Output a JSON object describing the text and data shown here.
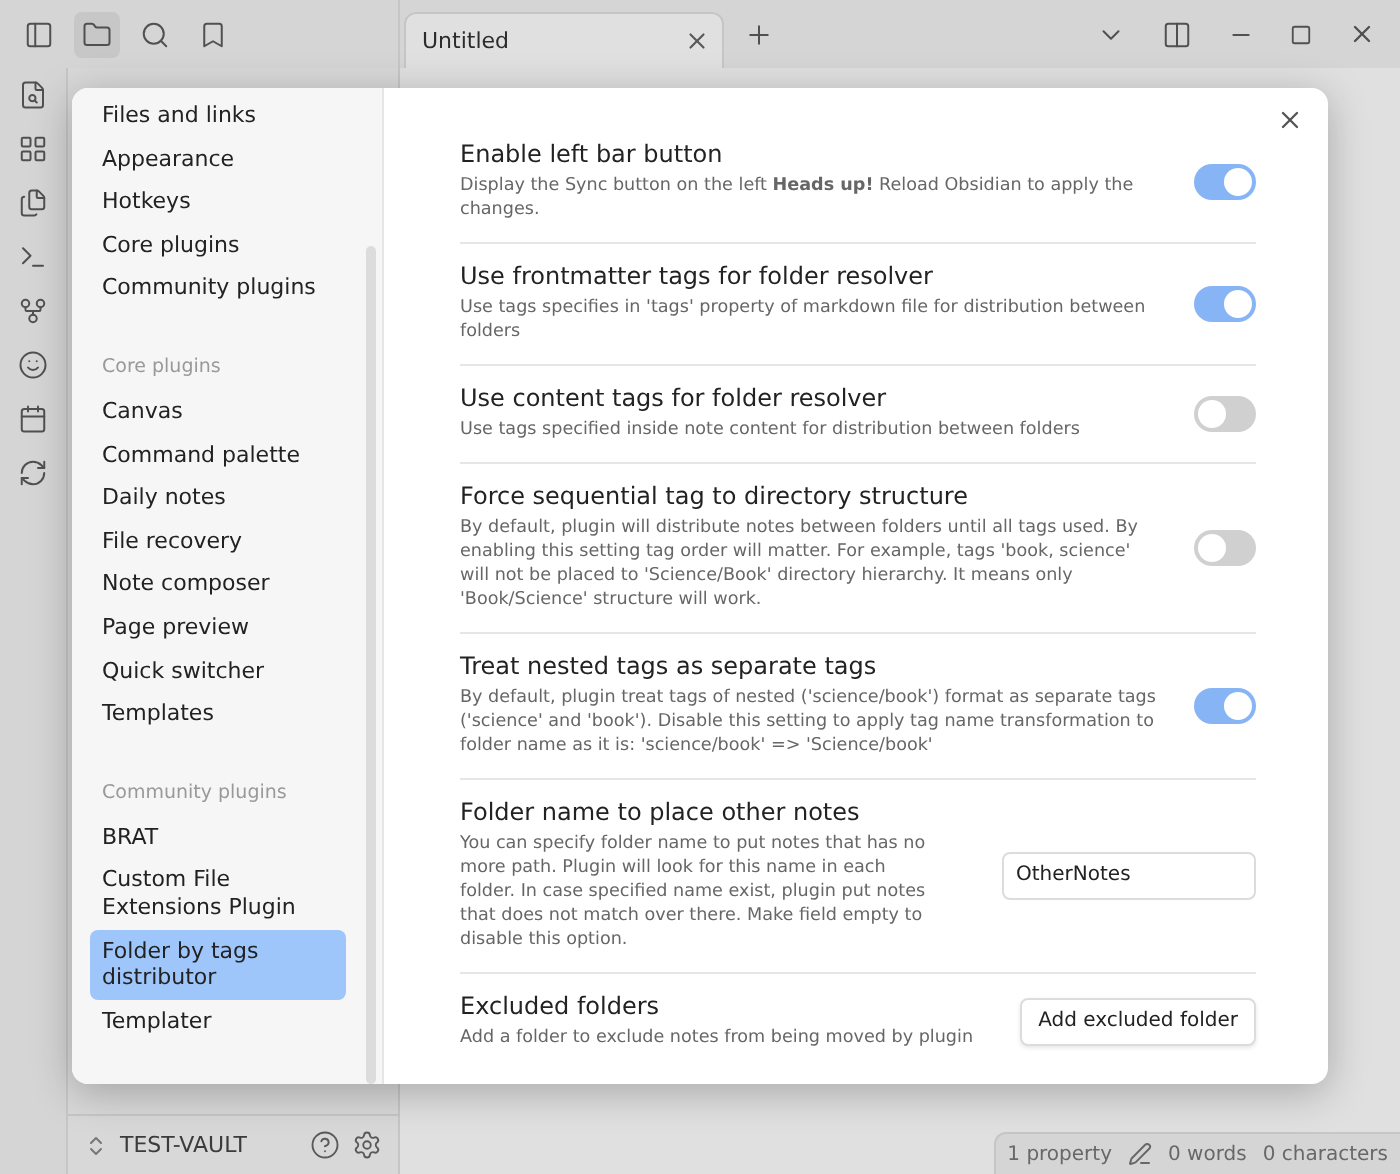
{
  "tab": {
    "title": "Untitled"
  },
  "settings_nav": [
    {
      "kind": "item",
      "label": "Files and links",
      "selected": false
    },
    {
      "kind": "item",
      "label": "Appearance",
      "selected": false
    },
    {
      "kind": "item",
      "label": "Hotkeys",
      "selected": false
    },
    {
      "kind": "item",
      "label": "Core plugins",
      "selected": false
    },
    {
      "kind": "item",
      "label": "Community plugins",
      "selected": false
    },
    {
      "kind": "heading",
      "label": "Core plugins"
    },
    {
      "kind": "item",
      "label": "Canvas",
      "selected": false
    },
    {
      "kind": "item",
      "label": "Command palette",
      "selected": false
    },
    {
      "kind": "item",
      "label": "Daily notes",
      "selected": false
    },
    {
      "kind": "item",
      "label": "File recovery",
      "selected": false
    },
    {
      "kind": "item",
      "label": "Note composer",
      "selected": false
    },
    {
      "kind": "item",
      "label": "Page preview",
      "selected": false
    },
    {
      "kind": "item",
      "label": "Quick switcher",
      "selected": false
    },
    {
      "kind": "item",
      "label": "Templates",
      "selected": false
    },
    {
      "kind": "heading",
      "label": "Community plugins"
    },
    {
      "kind": "item",
      "label": "BRAT",
      "selected": false
    },
    {
      "kind": "item",
      "label": "Custom File Extensions Plugin",
      "selected": false
    },
    {
      "kind": "item",
      "label": "Folder by tags distributor",
      "selected": true
    },
    {
      "kind": "item",
      "label": "Templater",
      "selected": false
    }
  ],
  "settings": [
    {
      "kind": "toggle",
      "name": "Enable left bar button",
      "description": "Display the Sync button on the left **Heads up!** Reload Obsidian to apply the changes.",
      "on": true
    },
    {
      "kind": "toggle",
      "name": "Use frontmatter tags for folder resolver",
      "description": "Use tags specifies in 'tags' property of markdown file for distribution between folders",
      "on": true
    },
    {
      "kind": "toggle",
      "name": "Use content tags for folder resolver",
      "description": "Use tags specified inside note content for distribution between folders",
      "on": false
    },
    {
      "kind": "toggle",
      "name": "Force sequential tag to directory structure",
      "description": "By default, plugin will distribute notes between folders until all tags used. By enabling this setting tag order will matter. For example, tags 'book, science' will not be placed to 'Science/Book' directory hierarchy. It means only 'Book/Science' structure will work.",
      "on": false
    },
    {
      "kind": "toggle",
      "name": "Treat nested tags as separate tags",
      "description": "By default, plugin treat tags of nested ('science/book') format as separate tags ('science' and 'book'). Disable this setting to apply tag name transformation to folder name as it is: 'science/book' => 'Science/book'",
      "on": true
    },
    {
      "kind": "text",
      "name": "Folder name to place other notes",
      "description": "You can specify folder name to put notes that has no more path. Plugin will look for this name in each folder. In case specified name exist, plugin put notes that does not match over there. Make field empty to disable this option.",
      "value": "OtherNotes"
    },
    {
      "kind": "button",
      "name": "Excluded folders",
      "description": "Add a folder to exclude notes from being moved by plugin",
      "button": "Add excluded folder"
    }
  ],
  "vault": {
    "name": "TEST-VAULT"
  },
  "status_bar": [
    "1 property",
    "0 words",
    "0 characters"
  ]
}
